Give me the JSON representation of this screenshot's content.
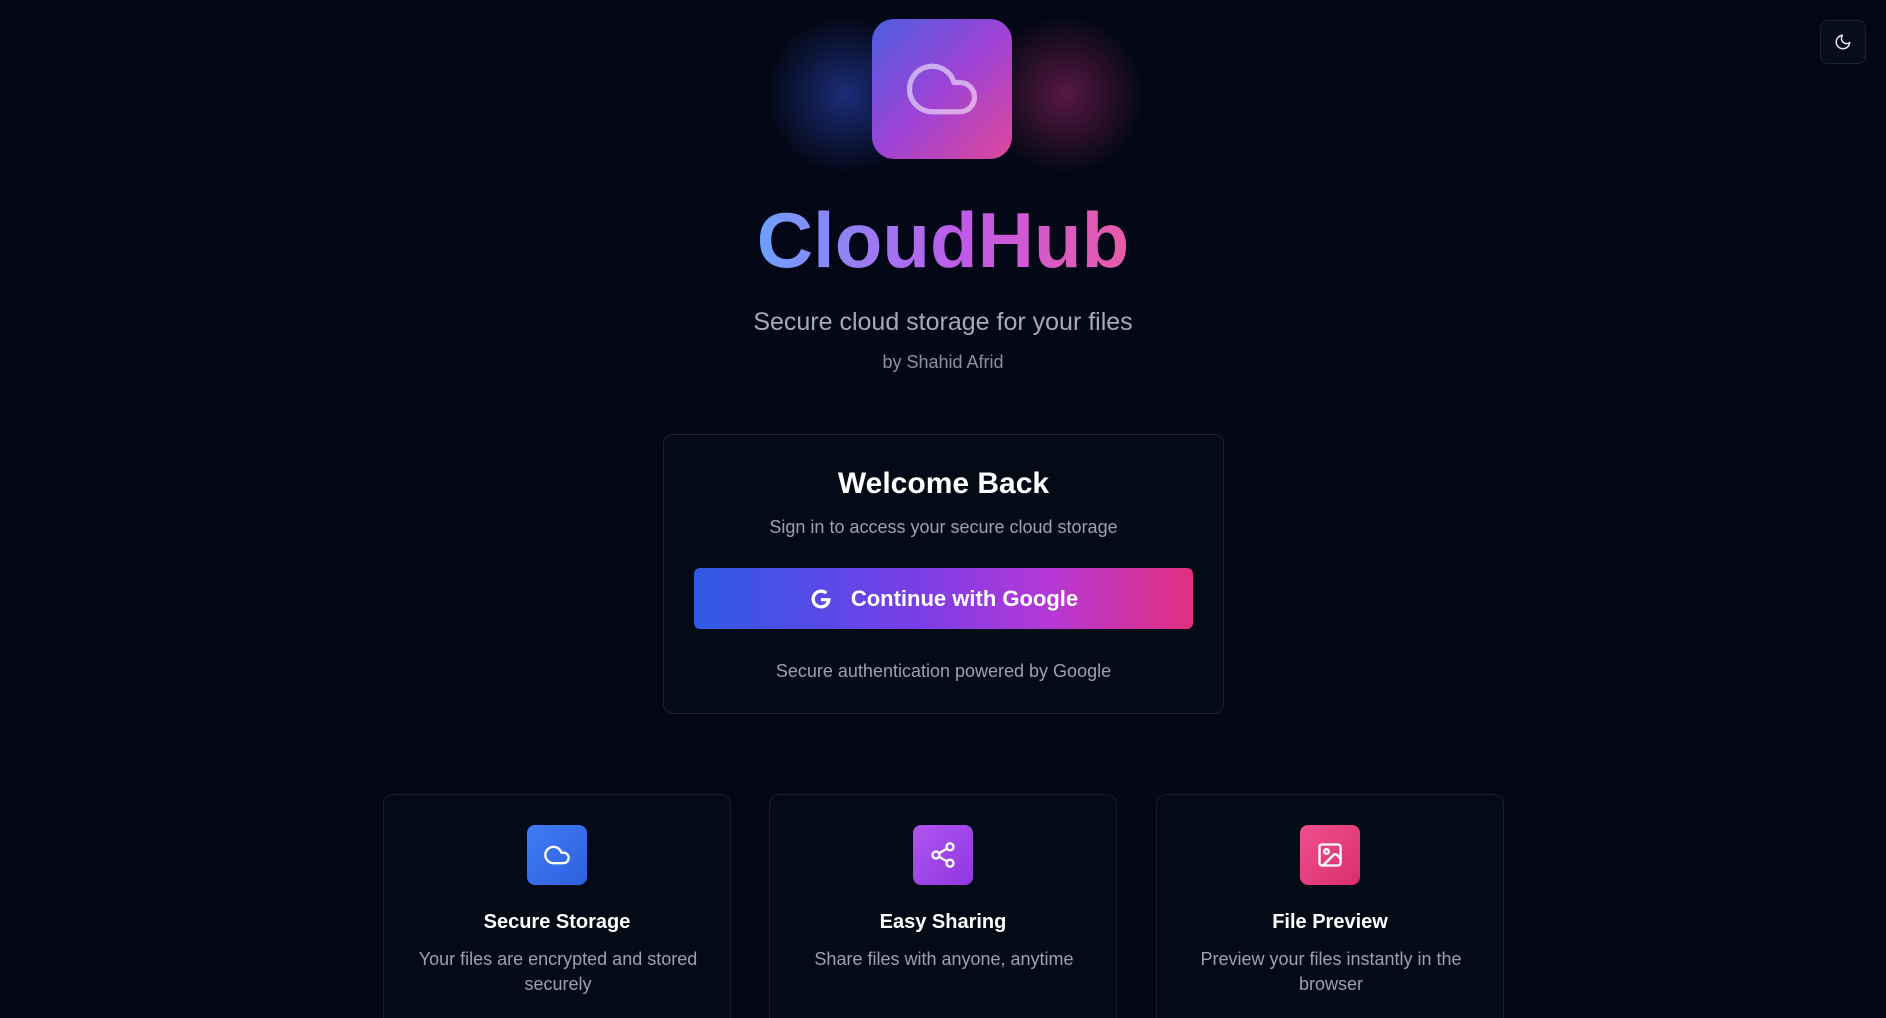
{
  "app": {
    "name": "CloudHub",
    "tagline": "Secure cloud storage for your files",
    "byline": "by Shahid Afrid"
  },
  "theme_toggle": {
    "icon": "moon-icon"
  },
  "login": {
    "title": "Welcome Back",
    "subtitle": "Sign in to access your secure cloud storage",
    "button_label": "Continue with Google",
    "button_icon": "google-icon",
    "note": "Secure authentication powered by Google"
  },
  "features": [
    {
      "title": "Secure Storage",
      "description": "Your files are encrypted and stored securely",
      "icon": "cloud-icon",
      "color": "#3b6ef0"
    },
    {
      "title": "Easy Sharing",
      "description": "Share files with anyone, anytime",
      "icon": "share-icon",
      "color": "#a445ec"
    },
    {
      "title": "File Preview",
      "description": "Preview your files instantly in the browser",
      "icon": "image-icon",
      "color": "#e8407f"
    }
  ],
  "colors": {
    "background": "#040816",
    "brand_gradient_start": "#6ea0ff",
    "brand_gradient_end": "#ea5ba8"
  }
}
